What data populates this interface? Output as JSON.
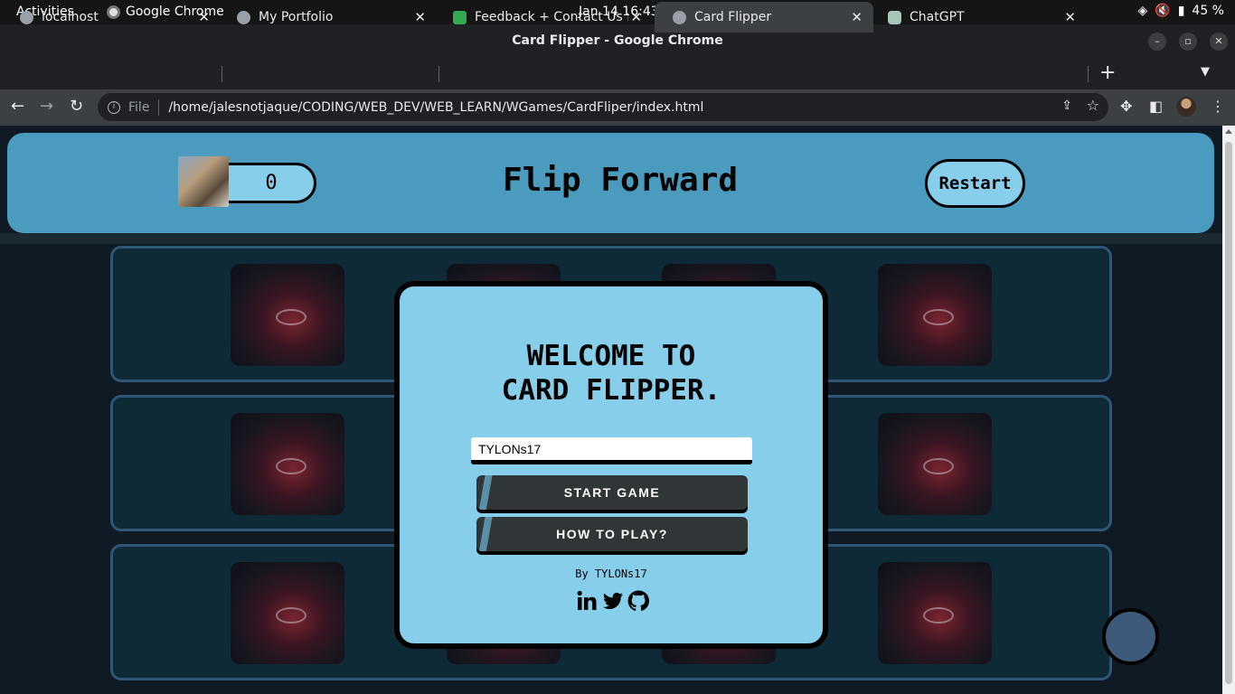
{
  "os": {
    "activities": "Activities",
    "app_name": "Google Chrome",
    "clock": "Jan 14  16:43",
    "battery": "45 %"
  },
  "window": {
    "title": "Card Flipper - Google Chrome"
  },
  "tabs": [
    {
      "label": "localhost",
      "active": false
    },
    {
      "label": "My Portfolio",
      "active": false
    },
    {
      "label": "Feedback + Contact Us fo",
      "active": false
    },
    {
      "label": "Card Flipper",
      "active": true
    },
    {
      "label": "ChatGPT",
      "active": false
    }
  ],
  "toolbar": {
    "scheme": "File",
    "url": "/home/jalesnotjaque/CODING/WEB_DEV/WEB_LEARN/WGames/CardFliper/index.html"
  },
  "page": {
    "score": "0",
    "heading": "Flip Forward",
    "restart_label": "Restart",
    "modal": {
      "welcome_line1": "WELCOME TO",
      "welcome_line2": "CARD FLIPPER.",
      "name_value": "TYLONs17",
      "start_label": "START GAME",
      "howto_label": "HOW TO PLAY?",
      "byline": "By TYLONs17",
      "socials": [
        "linkedin-icon",
        "twitter-icon",
        "github-icon"
      ]
    }
  },
  "colors": {
    "header_bg": "#4a9bbd",
    "accent_light_blue": "#87ceeb",
    "row_border": "#2f5577",
    "button_dark": "#303638"
  }
}
